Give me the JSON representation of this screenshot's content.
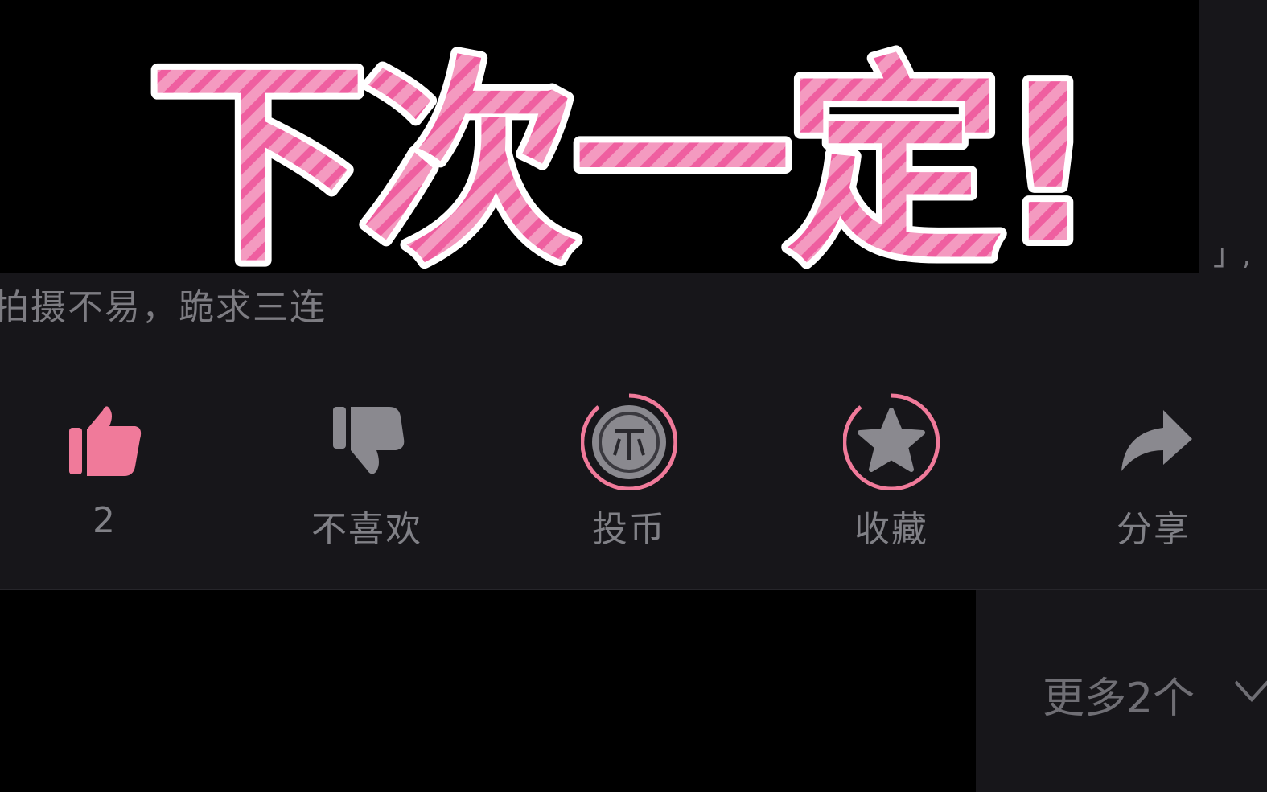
{
  "overlay": {
    "title": "下次一定!"
  },
  "description": {
    "text": "拍摄不易，跪求三连",
    "fragment": "」,"
  },
  "actions": [
    {
      "label": "2",
      "icon": "thumbs-up-icon",
      "active": true
    },
    {
      "label": "不喜欢",
      "icon": "thumbs-down-icon",
      "active": false
    },
    {
      "label": "投币",
      "icon": "coin-icon",
      "active": false
    },
    {
      "label": "收藏",
      "icon": "star-icon",
      "active": false
    },
    {
      "label": "分享",
      "icon": "share-arrow-icon",
      "active": false
    }
  ],
  "more": {
    "label": "更多2个",
    "icon": "chevron-down-icon"
  },
  "colors": {
    "accent_pink": "#f07a9a",
    "background": "#17161a",
    "icon_gray": "#8a898f",
    "text_gray": "#808086"
  }
}
